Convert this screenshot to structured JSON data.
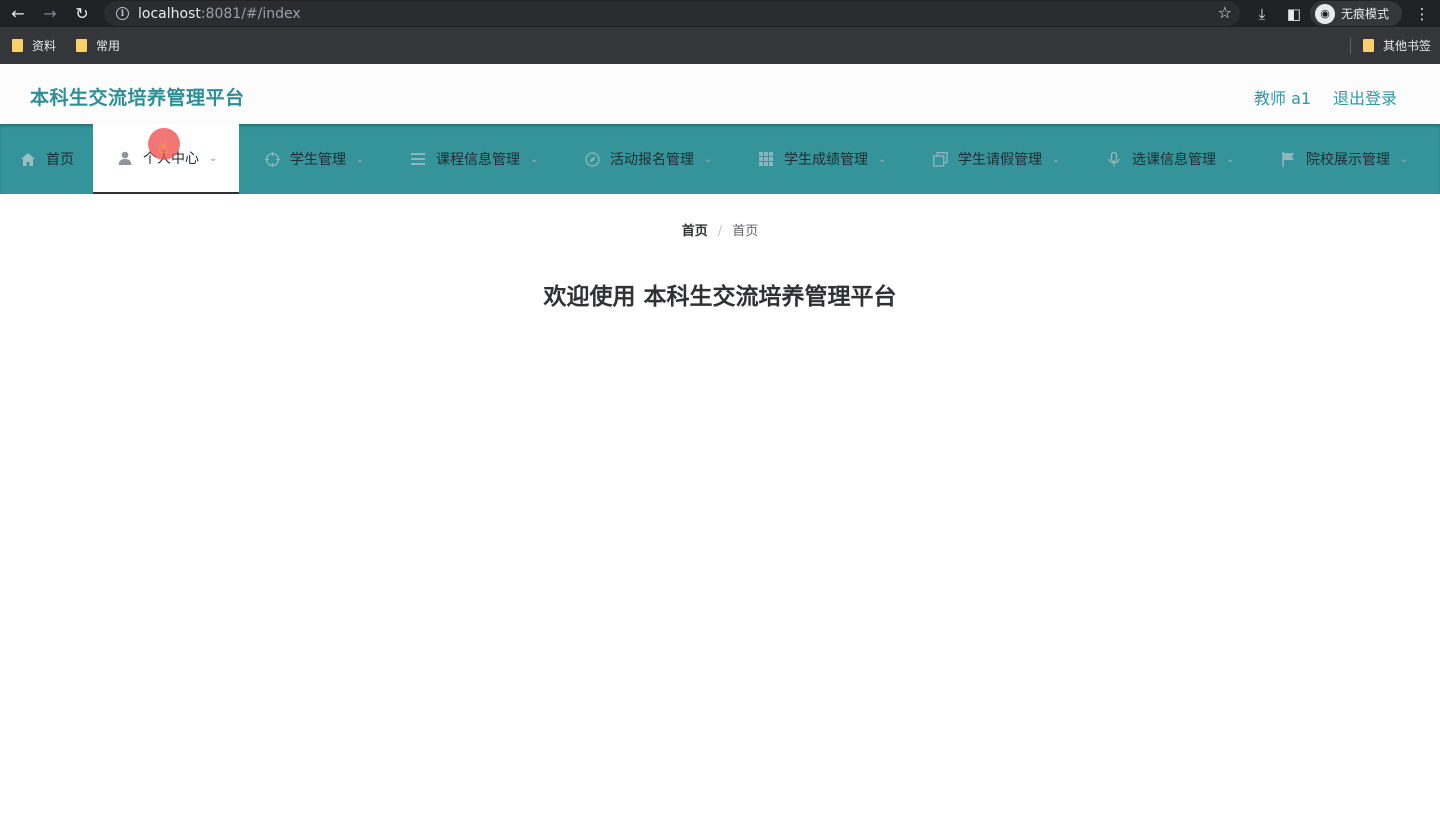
{
  "browser": {
    "url_host": "localhost",
    "url_rest": ":8081/#/index",
    "incognito_label": "无痕模式",
    "bookmarks": [
      "资料",
      "常用"
    ],
    "other_bookmarks": "其他书签"
  },
  "header": {
    "title": "本科生交流培养管理平台",
    "user": "教师 a1",
    "logout": "退出登录"
  },
  "nav": {
    "items": [
      {
        "label": "首页",
        "icon": "home-icon"
      },
      {
        "label": "个人中心",
        "icon": "user-icon",
        "active": true
      },
      {
        "label": "学生管理",
        "icon": "aim-icon"
      },
      {
        "label": "课程信息管理",
        "icon": "menu-icon"
      },
      {
        "label": "活动报名管理",
        "icon": "compass-icon"
      },
      {
        "label": "学生成绩管理",
        "icon": "grid-icon"
      },
      {
        "label": "学生请假管理",
        "icon": "copy-icon"
      },
      {
        "label": "选课信息管理",
        "icon": "microphone-icon"
      },
      {
        "label": "院校展示管理",
        "icon": "flag-icon"
      }
    ]
  },
  "breadcrumb": [
    "首页",
    "首页"
  ],
  "welcome": "欢迎使用 本科生交流培养管理平台",
  "colors": {
    "brand": "#2d8e96",
    "nav_bg": "#35939a"
  }
}
